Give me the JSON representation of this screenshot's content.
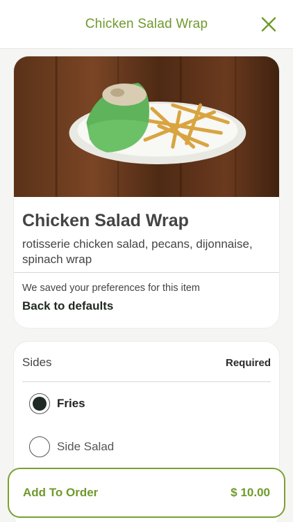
{
  "header": {
    "title": "Chicken Salad Wrap"
  },
  "item": {
    "image_alt": "Chicken Salad Wrap with fries",
    "name": "Chicken Salad Wrap",
    "description": "rotisserie chicken salad, pecans, dijonnaise, spinach wrap",
    "saved_note": "We saved your preferences for this item",
    "back_to_defaults": "Back to defaults"
  },
  "sides": {
    "title": "Sides",
    "required": "Required",
    "options": [
      {
        "label": "Fries",
        "selected": true
      },
      {
        "label": "Side Salad",
        "selected": false
      }
    ]
  },
  "footer": {
    "add_label": "Add To Order",
    "price": "$ 10.00"
  },
  "colors": {
    "accent": "#6f9a2c",
    "accent_border": "#79a02f",
    "radio_fill": "#1f2a23"
  }
}
